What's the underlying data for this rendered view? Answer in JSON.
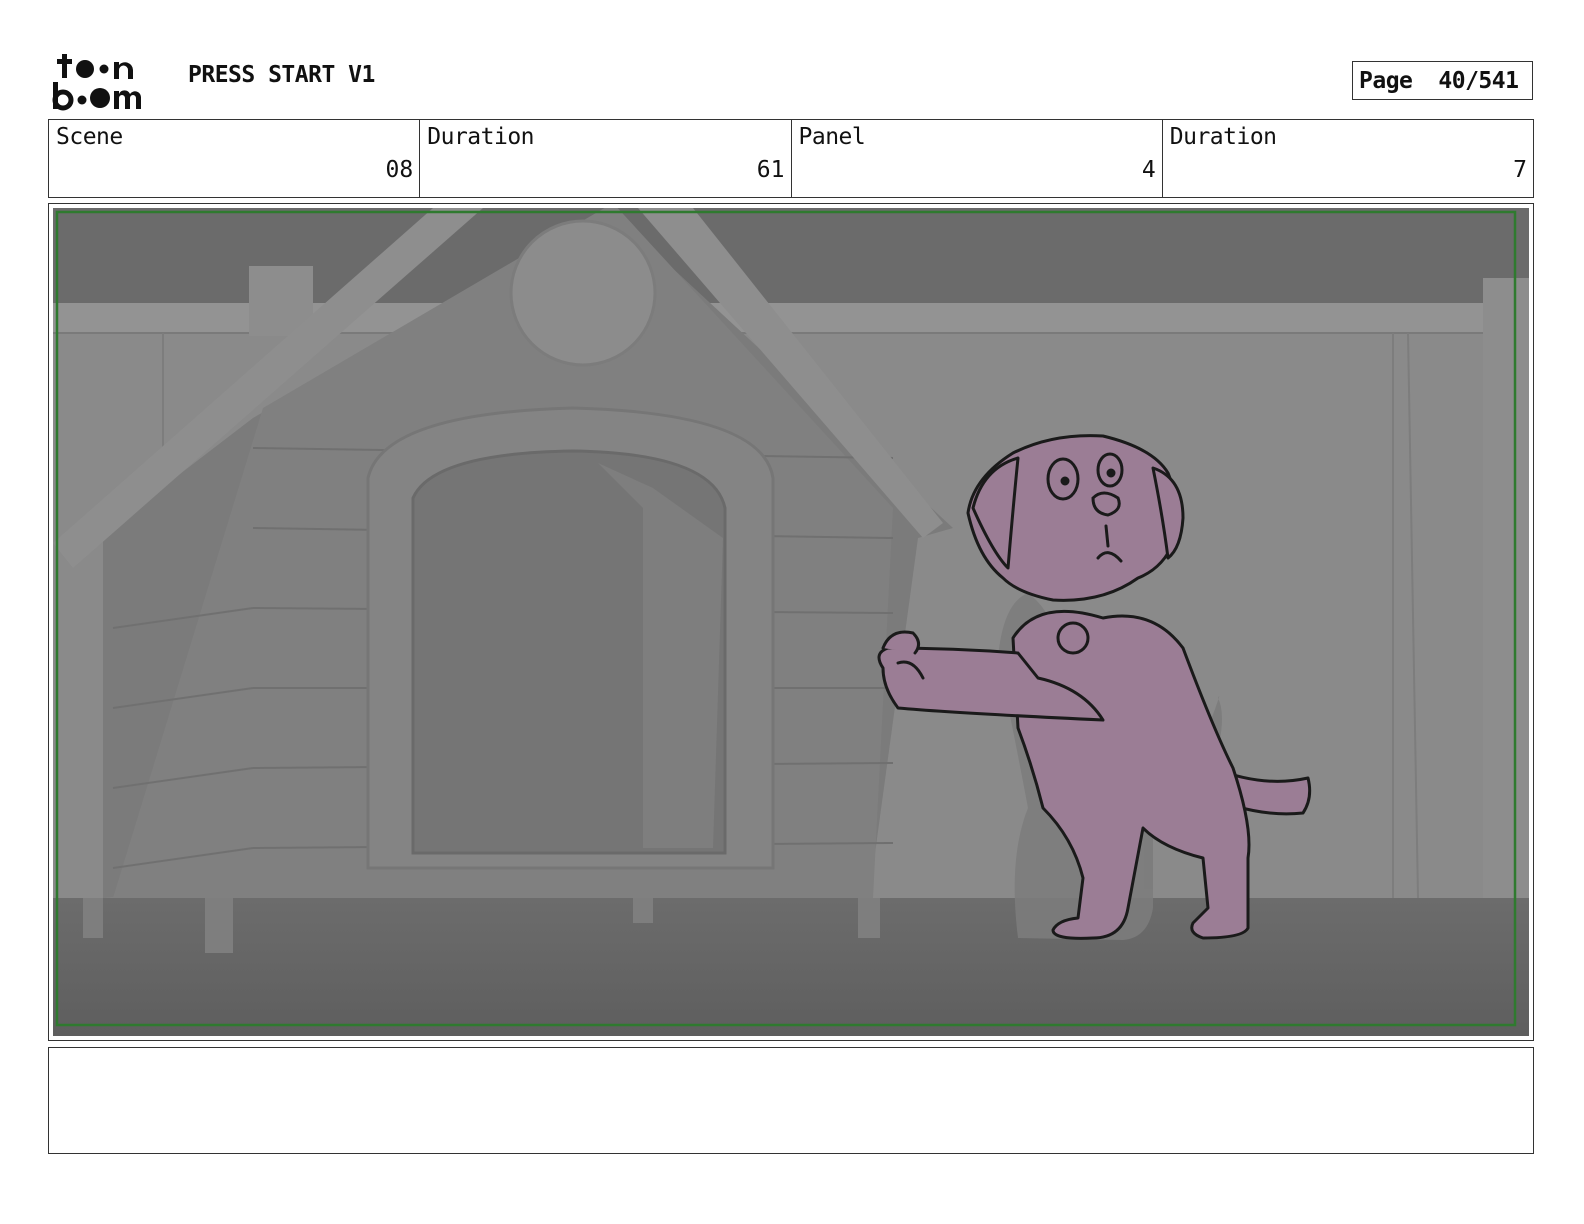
{
  "header": {
    "logo_text": "toon boom",
    "project_title": "PRESS START V1",
    "page_label": "Page",
    "page_value": "40/541"
  },
  "info": {
    "scene_label": "Scene",
    "scene_value": "08",
    "scene_duration_label": "Duration",
    "scene_duration_value": "61",
    "panel_label": "Panel",
    "panel_value": "4",
    "panel_duration_label": "Duration",
    "panel_duration_value": "7"
  },
  "colors": {
    "safe_frame": "#2f7a2f",
    "dog_fill": "#9b7d95",
    "background_gray": "#8a8a8a"
  },
  "notes": {
    "text": ""
  }
}
